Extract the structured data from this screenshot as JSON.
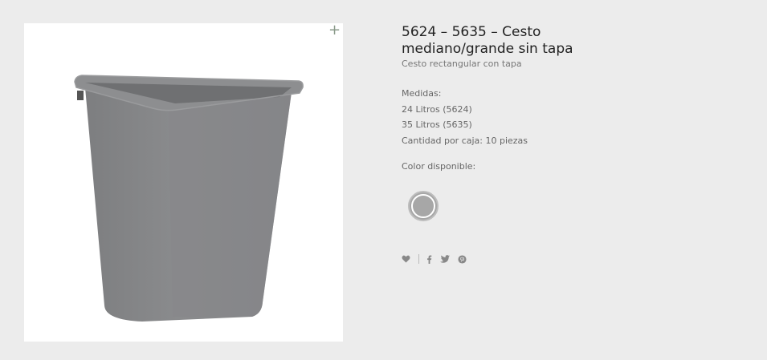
{
  "product": {
    "title": "5624 – 5635 – Cesto mediano/grande sin tapa",
    "subtitle": "Cesto rectangular con tapa",
    "details": [
      "Medidas:",
      "24 Litros (5624)",
      "35 Litros (5635)",
      "Cantidad por caja: 10 piezas"
    ],
    "color_label": "Color disponible:",
    "colors": [
      "#a7a7a7"
    ]
  },
  "icons": {
    "zoom": "plus-icon",
    "wishlist": "heart-icon",
    "share": [
      "facebook-icon",
      "twitter-icon",
      "pinterest-icon"
    ]
  },
  "zoom_glyph": "+"
}
